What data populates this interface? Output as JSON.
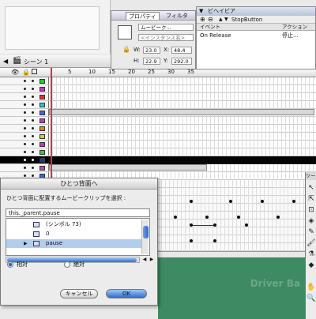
{
  "scene": {
    "label": "シーン 1"
  },
  "properties": {
    "tabs": [
      "プロパティ",
      "フィルタ"
    ],
    "symbol_type": "ムービーク...",
    "instance_name_placeholder": "<インスタンス名>",
    "w_label": "W:",
    "w_value": "23.0",
    "x_label": "X:",
    "x_value": "48.4",
    "h_label": "H:",
    "h_value": "22.9",
    "y_label": "Y:",
    "y_value": "292.0"
  },
  "behaviors": {
    "title": "ビヘイビア",
    "target": "StopButton",
    "col_event": "イベント",
    "col_action": "アクション",
    "row_event": "On Release",
    "row_action": "停止..."
  },
  "timeline": {
    "frame_numbers": [
      "1",
      "5",
      "10",
      "15",
      "20",
      "25",
      "30",
      "35"
    ],
    "layer_count": 13,
    "layer_colors": [
      "#22cc22",
      "#cc33cc",
      "#dd3333",
      "#22cccc",
      "#4466ee",
      "#cc33cc",
      "#ff7722",
      "#ddcc22",
      "#cc33cc",
      "#33cc33",
      "#2233aa",
      "#cc44aa",
      "#3366dd"
    ]
  },
  "dialog": {
    "title": "ひとつ背面へ",
    "prompt": "ひとつ背面に配置するムービークリップを選択 :",
    "path_value": "this._parent.pause",
    "tree": [
      {
        "label": "(シンボル 73)",
        "selected": false
      },
      {
        "label": "0",
        "selected": false
      },
      {
        "label": "pause",
        "selected": true
      }
    ],
    "radio_relative": "相対",
    "radio_absolute": "絶対",
    "cancel_label": "キャンセル",
    "ok_label": "OK"
  },
  "tools": {
    "header": "ツー",
    "items": [
      "arrow",
      "subselect",
      "free-transform",
      "paint-bucket",
      "pencil",
      "brush",
      "ink-bottle",
      "eraser",
      "hand",
      "zoom"
    ]
  },
  "stage": {
    "background_color": "#3d8a63",
    "watermark_text": "Driver Ba"
  }
}
